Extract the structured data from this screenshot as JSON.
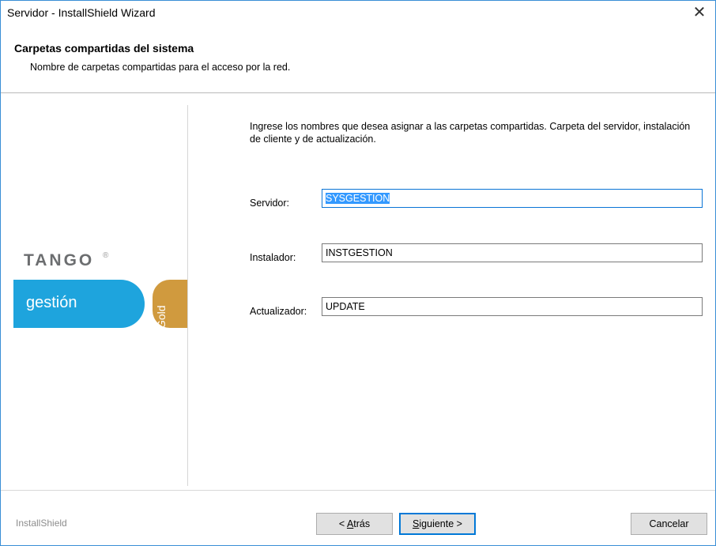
{
  "window": {
    "title": "Servidor - InstallShield Wizard",
    "close_glyph": "✕"
  },
  "header": {
    "title": "Carpetas compartidas del sistema",
    "subtitle": "Nombre de carpetas compartidas para el acceso por la red."
  },
  "branding": {
    "logo_text": "TANGO",
    "logo_mark": "®",
    "product": "gestión",
    "edition": "Gold",
    "product_color": "#1ea4dd",
    "edition_color": "#d09a3e"
  },
  "main": {
    "instructions": "Ingrese los nombres que desea asignar a las carpetas compartidas. Carpeta del servidor, instalación de cliente y de actualización.",
    "fields": [
      {
        "label": "Servidor:",
        "value": "SYSGESTION",
        "selected": true
      },
      {
        "label": "Instalador:",
        "value": "INSTGESTION",
        "selected": false
      },
      {
        "label": "Actualizador:",
        "value": "UPDATE",
        "selected": false
      }
    ]
  },
  "footer": {
    "brand": "InstallShield",
    "back_prefix": "< ",
    "back_accel": "A",
    "back_rest": "trás",
    "next_accel": "S",
    "next_rest": "iguiente >",
    "cancel_label": "Cancelar"
  }
}
